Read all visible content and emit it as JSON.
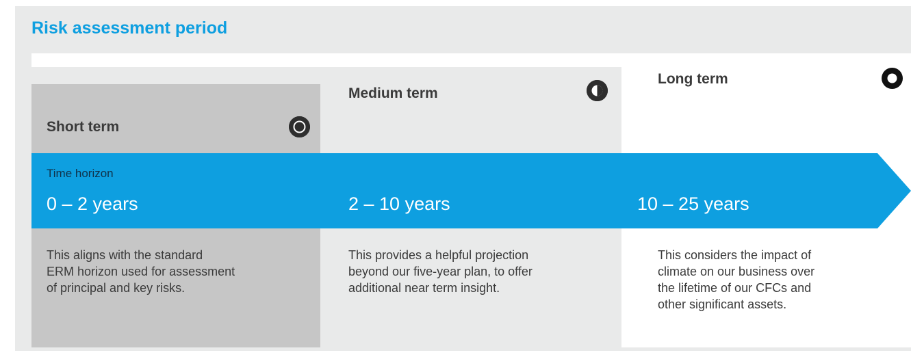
{
  "title": "Risk assessment period",
  "colors": {
    "accent_blue": "#0e9fe0",
    "short_bg": "#c6c6c6",
    "medium_bg": "#e9eaea",
    "long_bg": "#ffffff",
    "icon_dark": "#2e2e2e"
  },
  "time_horizon_label": "Time horizon",
  "terms": [
    {
      "name": "Short term",
      "icon": "circle-outline-icon",
      "range": "0 – 2 years",
      "description": [
        "This aligns with the standard",
        "ERM horizon used for assessment",
        "of principal and key risks."
      ]
    },
    {
      "name": "Medium term",
      "icon": "half-filled-circle-icon",
      "range": "2 – 10 years",
      "description": [
        "This provides a helpful projection",
        "beyond our five-year plan, to offer",
        "additional near term insight."
      ]
    },
    {
      "name": "Long term",
      "icon": "ring-icon",
      "range": "10 – 25 years",
      "description": [
        "This considers the impact of",
        "climate on our business over",
        "the lifetime of our CFCs and",
        "other significant assets."
      ]
    }
  ]
}
